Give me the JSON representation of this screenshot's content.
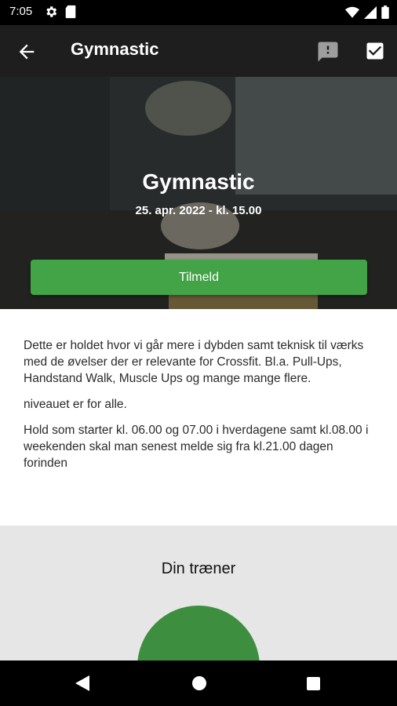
{
  "status_bar": {
    "time": "7:05",
    "icons": [
      "gear-icon",
      "sd-card-icon",
      "wifi-icon",
      "cell-signal-icon",
      "battery-icon"
    ]
  },
  "app_bar": {
    "title": "Gymnastic",
    "icons": [
      "back-arrow-icon",
      "comment-icon",
      "checkbox-icon"
    ]
  },
  "hero": {
    "title": "Gymnastic",
    "datetime": "25. apr. 2022 - kl. 15.00",
    "signup_label": "Tilmeld"
  },
  "description": {
    "paragraphs": [
      "Dette er holdet hvor vi går mere i dybden samt teknisk til værks med de øvelser der er relevante for Crossfit. Bl.a. Pull-Ups, Handstand Walk, Muscle Ups og mange mange flere.",
      "niveauet er for alle.",
      "Hold som starter kl. 06.00 og 07.00 i hverdagene samt kl.08.00 i weekenden skal man senest melde sig fra kl.21.00 dagen forinden"
    ]
  },
  "trainer": {
    "heading": "Din træner"
  },
  "colors": {
    "accent_green": "#43a347",
    "avatar_green": "#3d8f3f",
    "app_bar": "#1e1e1e"
  },
  "nav_bar": {
    "icons": [
      "nav-back-icon",
      "nav-home-icon",
      "nav-recents-icon"
    ]
  }
}
